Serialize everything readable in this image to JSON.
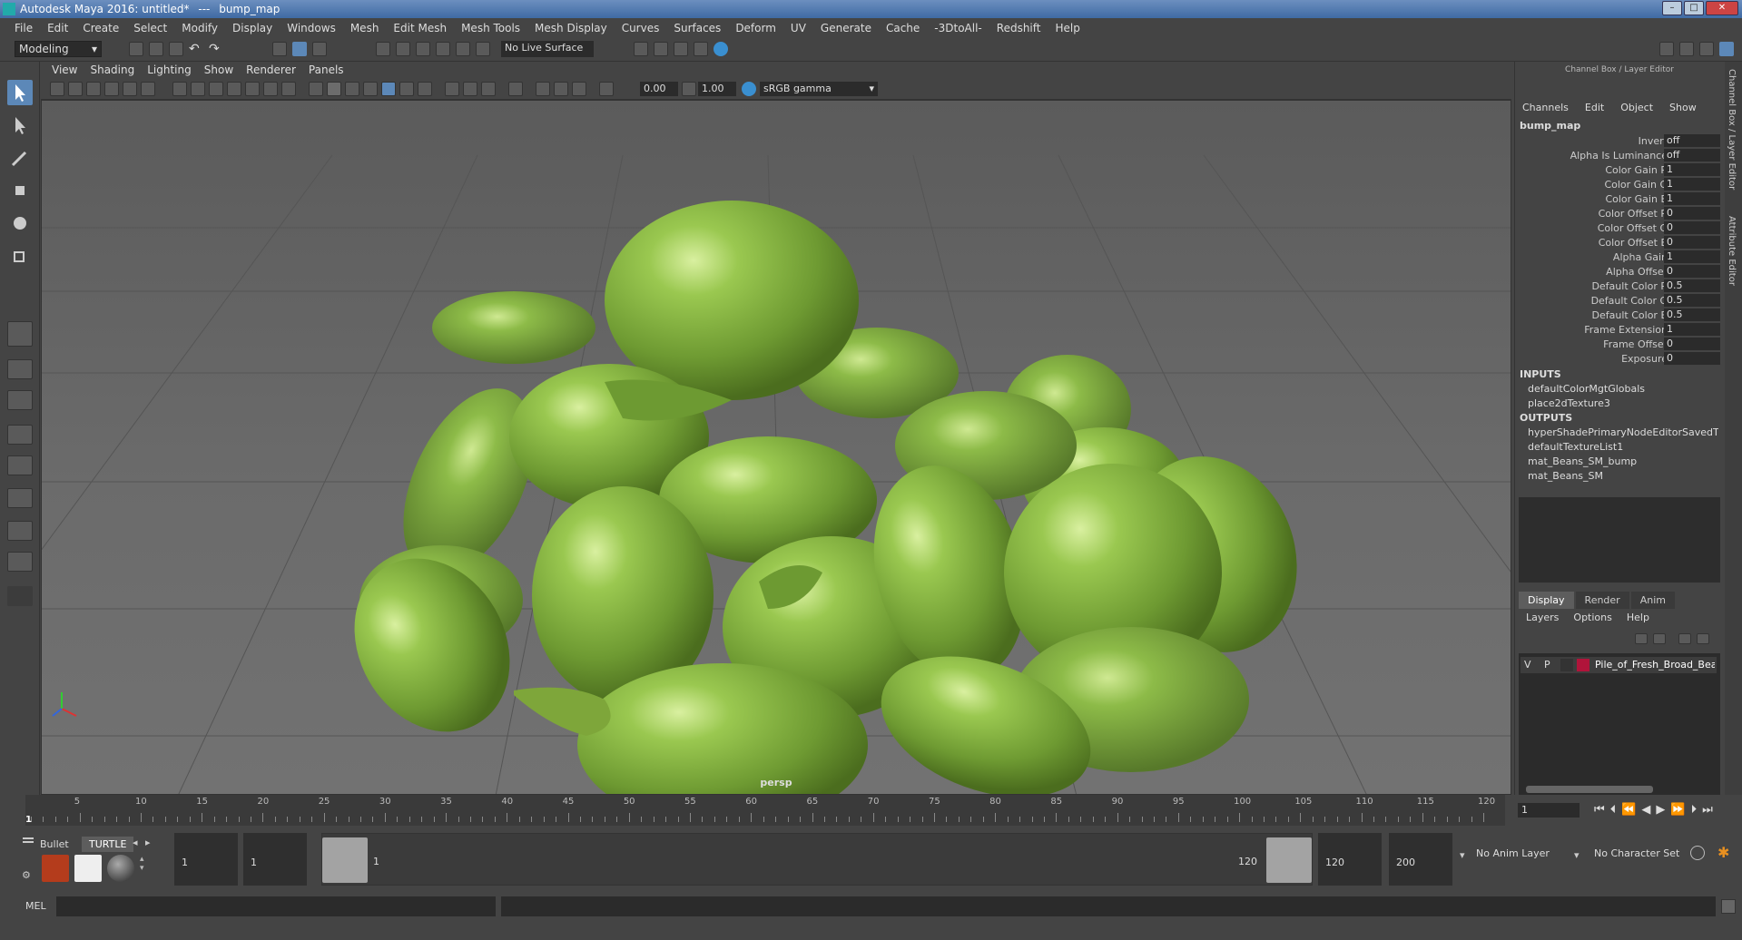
{
  "window": {
    "app_title": "Autodesk Maya 2016: untitled*",
    "separator": "---",
    "node": "bump_map"
  },
  "menus": [
    "File",
    "Edit",
    "Create",
    "Select",
    "Modify",
    "Display",
    "Windows",
    "Mesh",
    "Edit Mesh",
    "Mesh Tools",
    "Mesh Display",
    "Curves",
    "Surfaces",
    "Deform",
    "UV",
    "Generate",
    "Cache",
    "-3DtoAll-",
    "Redshift",
    "Help"
  ],
  "shelf": {
    "mode": "Modeling",
    "live_surface": "No Live Surface"
  },
  "viewport": {
    "menus": [
      "View",
      "Shading",
      "Lighting",
      "Show",
      "Renderer",
      "Panels"
    ],
    "exposure": "0.00",
    "gamma": "1.00",
    "color_space": "sRGB gamma",
    "camera": "persp"
  },
  "channel_box": {
    "header": "Channel Box / Layer Editor",
    "menus": [
      "Channels",
      "Edit",
      "Object",
      "Show"
    ],
    "node": "bump_map",
    "attributes": [
      {
        "label": "Invert",
        "value": "off"
      },
      {
        "label": "Alpha Is Luminance",
        "value": "off"
      },
      {
        "label": "Color Gain R",
        "value": "1"
      },
      {
        "label": "Color Gain G",
        "value": "1"
      },
      {
        "label": "Color Gain B",
        "value": "1"
      },
      {
        "label": "Color Offset R",
        "value": "0"
      },
      {
        "label": "Color Offset G",
        "value": "0"
      },
      {
        "label": "Color Offset B",
        "value": "0"
      },
      {
        "label": "Alpha Gain",
        "value": "1"
      },
      {
        "label": "Alpha Offset",
        "value": "0"
      },
      {
        "label": "Default Color R",
        "value": "0.5"
      },
      {
        "label": "Default Color G",
        "value": "0.5"
      },
      {
        "label": "Default Color B",
        "value": "0.5"
      },
      {
        "label": "Frame Extension",
        "value": "1"
      },
      {
        "label": "Frame Offset",
        "value": "0"
      },
      {
        "label": "Exposure",
        "value": "0"
      }
    ],
    "inputs_label": "INPUTS",
    "inputs": [
      "defaultColorMgtGlobals",
      "place2dTexture3"
    ],
    "outputs_label": "OUTPUTS",
    "outputs": [
      "hyperShadePrimaryNodeEditorSavedT...",
      "defaultTextureList1",
      "mat_Beans_SM_bump",
      "mat_Beans_SM"
    ]
  },
  "layer_editor": {
    "tabs": [
      "Display",
      "Render",
      "Anim"
    ],
    "menus": [
      "Layers",
      "Options",
      "Help"
    ],
    "layer": {
      "v": "V",
      "p": "P",
      "name": "Pile_of_Fresh_Broad_Bea",
      "color": "#b0143a"
    }
  },
  "side_tabs": [
    "Channel Box / Layer Editor",
    "Attribute Editor"
  ],
  "timeline": {
    "ticks": [
      "5",
      "10",
      "15",
      "20",
      "25",
      "30",
      "35",
      "40",
      "45",
      "50",
      "55",
      "60",
      "65",
      "70",
      "75",
      "80",
      "85",
      "90",
      "95",
      "100",
      "105",
      "110",
      "115",
      "120"
    ],
    "start": "1",
    "current_frame": "1"
  },
  "shelf_tabs": [
    "Bullet",
    "TURTLE"
  ],
  "range": {
    "start": "1",
    "playback_start": "1",
    "slider_start": "1",
    "slider_end": "120",
    "playback_end": "120",
    "end": "200",
    "anim_layer": "No Anim Layer",
    "char_set": "No Character Set"
  },
  "command_line": {
    "lang": "MEL"
  }
}
